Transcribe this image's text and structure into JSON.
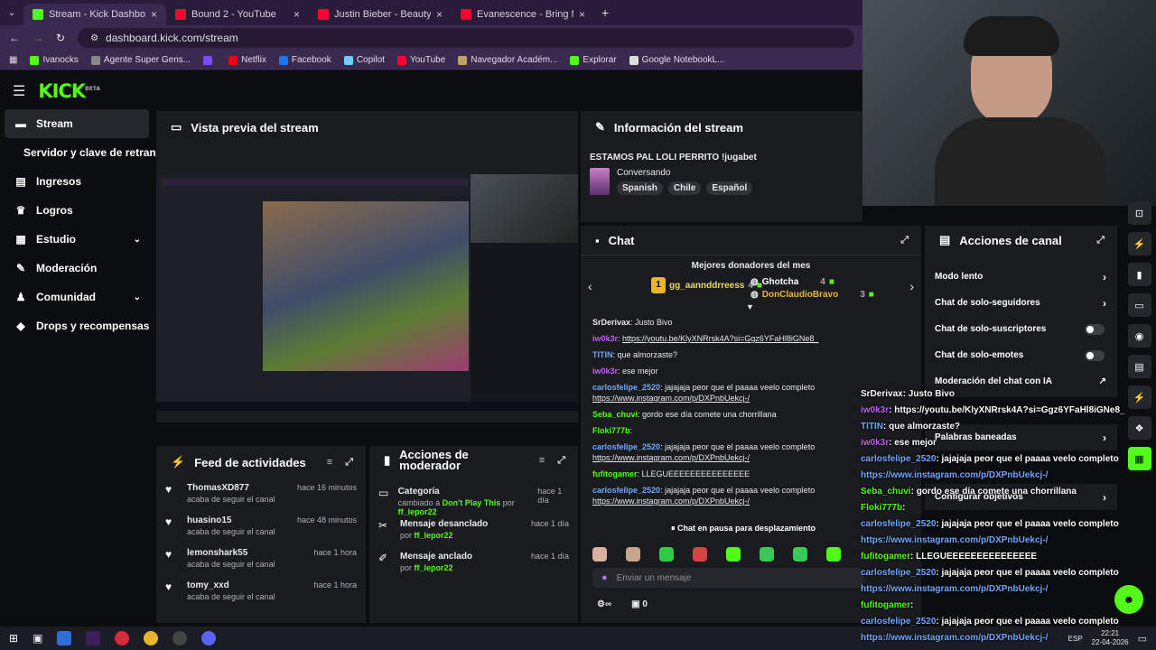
{
  "browser": {
    "tabs": [
      {
        "title": "Stream - Kick Dashboard",
        "color": "#53fc18",
        "active": true
      },
      {
        "title": "Bound 2 - YouTube",
        "color": "#ff0033",
        "active": false
      },
      {
        "title": "Justin Bieber - Beauty And A B",
        "color": "#ff0033",
        "active": false
      },
      {
        "title": "Evanescence - Bring Me To Life",
        "color": "#ff0033",
        "active": false
      }
    ],
    "url": "dashboard.kick.com/stream",
    "bookmarks": [
      {
        "label": "Ivanocks",
        "color": "#53fc18"
      },
      {
        "label": "Agente Super Gens...",
        "color": "#888888"
      },
      {
        "label": "",
        "color": "#7b4cff"
      },
      {
        "label": "Netflix",
        "color": "#e50914"
      },
      {
        "label": "Facebook",
        "color": "#1877f2"
      },
      {
        "label": "Copilot",
        "color": "#6bd0ff"
      },
      {
        "label": "YouTube",
        "color": "#ff0033"
      },
      {
        "label": "Navegador Académ...",
        "color": "#c0a060"
      },
      {
        "label": "Explorar",
        "color": "#53fc18"
      },
      {
        "label": "Google NotebookL...",
        "color": "#dddddd"
      }
    ]
  },
  "kick": {
    "logo": "KICK",
    "beta": "BETA"
  },
  "sidebar": {
    "items": [
      {
        "label": "Stream",
        "icon": "tv-icon",
        "glyph": "▬"
      },
      {
        "label": "Servidor y clave de retransmisión",
        "icon": "",
        "glyph": ""
      },
      {
        "label": "Ingresos",
        "icon": "money-icon",
        "glyph": "▤"
      },
      {
        "label": "Logros",
        "icon": "trophy-icon",
        "glyph": "♛"
      },
      {
        "label": "Estudio",
        "icon": "studio-icon",
        "glyph": "▦"
      },
      {
        "label": "Moderación",
        "icon": "wrench-icon",
        "glyph": "✎"
      },
      {
        "label": "Comunidad",
        "icon": "community-icon",
        "glyph": "♟"
      },
      {
        "label": "Drops y recompensas",
        "icon": "gift-icon",
        "glyph": "◆"
      }
    ]
  },
  "preview": {
    "title": "Vista previa del stream"
  },
  "activity": {
    "title": "Feed de actividades",
    "items": [
      {
        "name": "ThomasXD877",
        "sub": "acaba de seguir el canal",
        "time": "hace 16 minutos"
      },
      {
        "name": "huasino15",
        "sub": "acaba de seguir el canal",
        "time": "hace 48 minutos"
      },
      {
        "name": "lemonshark55",
        "sub": "acaba de seguir el canal",
        "time": "hace 1 hora"
      },
      {
        "name": "tomy_xxd",
        "sub": "acaba de seguir el canal",
        "time": "hace 1 hora"
      }
    ]
  },
  "modactions": {
    "title": "Acciones de moderador",
    "items": [
      {
        "title": "Categoría",
        "pre": "cambiado a",
        "target": "Don't Play This",
        "mid": "por",
        "user": "ff_lepor22",
        "time": "hace 1 día"
      },
      {
        "title": "Mensaje desanclado",
        "pre": "",
        "target": "",
        "mid": "por",
        "user": "ff_lepor22",
        "time": "hace 1 día"
      },
      {
        "title": "Mensaje anclado",
        "pre": "",
        "target": "",
        "mid": "por",
        "user": "ff_lepor22",
        "time": "hace 1 día"
      }
    ]
  },
  "info": {
    "title": "Información del stream",
    "stream_title": "ESTAMOS PAL LOLI PERRITO !jugabet",
    "category": "Conversando",
    "tags": [
      "Spanish",
      "Chile",
      "Español"
    ]
  },
  "chat": {
    "title": "Chat",
    "donors_title": "Mejores donadores del mes",
    "donors": [
      {
        "rank": "1",
        "name": "gg_aannddrreess",
        "amount": "4"
      },
      {
        "rank": "",
        "name": "Ghotcha",
        "amount": "4"
      },
      {
        "rank": "",
        "name": "DonClaudioBravo",
        "amount": "3"
      }
    ],
    "messages": [
      {
        "user": "SrDerivax",
        "color": "#e8eaed",
        "text": "Justo Bivo",
        "link": false
      },
      {
        "user": "iw0k3r",
        "color": "#c45cff",
        "text": "https://youtu.be/KlyXNRrsk4A?si=Ggz6YFaHl8iGNe8_",
        "link": true
      },
      {
        "user": "TITIN",
        "color": "#6fa8ff",
        "text": "que almorzaste?",
        "link": false
      },
      {
        "user": "iw0k3r",
        "color": "#c45cff",
        "text": "ese mejor",
        "link": false
      },
      {
        "user": "carlosfelipe_2520",
        "color": "#6fa8ff",
        "text": "jajajaja peor que el paaaa veelo completo",
        "text2": "https://www.instagram.com/p/DXPnbUekcj-/",
        "link": false
      },
      {
        "user": "Seba_chuvi",
        "color": "#53fc18",
        "text": "gordo ese día comete una chorrillana",
        "link": false
      },
      {
        "user": "Floki777b",
        "color": "#53fc18",
        "text": "",
        "link": false
      },
      {
        "user": "carlosfelipe_2520",
        "color": "#6fa8ff",
        "text": "jajajaja peor que el paaaa veelo completo",
        "text2": "https://www.instagram.com/p/DXPnbUekcj-/",
        "link": false
      },
      {
        "user": "fufitogamer",
        "color": "#53fc18",
        "text": "LLEGUEEEEEEEEEEEEEEE",
        "link": false
      },
      {
        "user": "carlosfelipe_2520",
        "color": "#6fa8ff",
        "text": "jajajaja peor que el paaaa veelo completo",
        "text2": "https://www.instagram.com/p/DXPnbUekcj-/",
        "link": false
      }
    ],
    "paused": "Chat en pausa para desplazamiento",
    "input_placeholder": "Enviar un mensaje",
    "count": "0"
  },
  "channel_actions": {
    "title": "Acciones de canal",
    "items": [
      {
        "label": "Modo lento",
        "kind": "chevron"
      },
      {
        "label": "Chat de solo-seguidores",
        "kind": "chevron"
      },
      {
        "label": "Chat de solo-suscriptores",
        "kind": "toggle"
      },
      {
        "label": "Chat de solo-emotes",
        "kind": "toggle"
      },
      {
        "label": "Moderación del chat con IA",
        "kind": "external"
      },
      {
        "label": "Palabras baneadas",
        "kind": "chevron"
      },
      {
        "label": "Configurar objetivos",
        "kind": "chevron"
      }
    ]
  },
  "overlay": {
    "lines": [
      {
        "user": "SrDerivax",
        "color": "#ffffff",
        "text": ": Justo Bivo"
      },
      {
        "user": "iw0k3r",
        "color": "#c45cff",
        "text": ": https://youtu.be/KlyXNRrsk4A?si=Ggz6YFaHl8iGNe8_"
      },
      {
        "user": "TITIN",
        "color": "#6fa8ff",
        "text": ": que almorzaste?"
      },
      {
        "user": "iw0k3r",
        "color": "#c45cff",
        "text": ": ese mejor"
      },
      {
        "user": "carlosfelipe_2520",
        "color": "#6fa8ff",
        "text": ": jajajaja peor que el paaaa veelo completo"
      },
      {
        "user": "",
        "color": "#6fa8ff",
        "text": "https://www.instagram.com/p/DXPnbUekcj-/"
      },
      {
        "user": "Seba_chuvi",
        "color": "#53fc18",
        "text": ": gordo ese día comete una chorrillana"
      },
      {
        "user": "Floki777b",
        "color": "#53fc18",
        "text": ":"
      },
      {
        "user": "carlosfelipe_2520",
        "color": "#6fa8ff",
        "text": ": jajajaja peor que el paaaa veelo completo"
      },
      {
        "user": "",
        "color": "#6fa8ff",
        "text": "https://www.instagram.com/p/DXPnbUekcj-/"
      },
      {
        "user": "fufitogamer",
        "color": "#53fc18",
        "text": ": LLEGUEEEEEEEEEEEEEEE"
      },
      {
        "user": "carlosfelipe_2520",
        "color": "#6fa8ff",
        "text": ": jajajaja peor que el paaaa veelo completo"
      },
      {
        "user": "",
        "color": "#6fa8ff",
        "text": "https://www.instagram.com/p/DXPnbUekcj-/"
      },
      {
        "user": "fufitogamer",
        "color": "#53fc18",
        "text": ":"
      },
      {
        "user": "carlosfelipe_2520",
        "color": "#6fa8ff",
        "text": ": jajajaja peor que el paaaa veelo completo"
      },
      {
        "user": "",
        "color": "#6fa8ff",
        "text": "https://www.instagram.com/p/DXPnbUekcj-/"
      }
    ]
  },
  "taskbar": {
    "lang": "ESP",
    "time": "22:21",
    "date": "22-04-2026"
  }
}
